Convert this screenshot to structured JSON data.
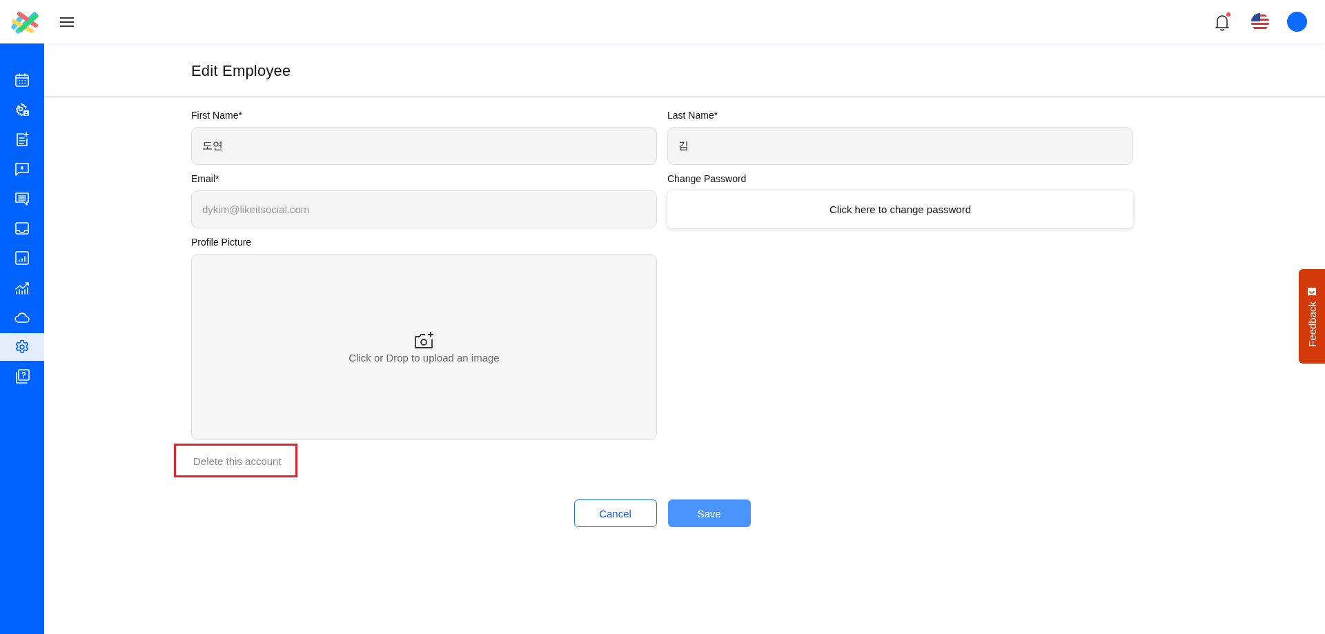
{
  "header": {
    "notifications": {
      "unread": true
    }
  },
  "sidebar": {
    "items": [
      {
        "kind": "calendar",
        "selected": false
      },
      {
        "kind": "gear-person",
        "selected": false
      },
      {
        "kind": "note-add",
        "selected": false
      },
      {
        "kind": "chat-spark",
        "selected": false
      },
      {
        "kind": "chat-lines",
        "selected": false
      },
      {
        "kind": "inbox",
        "selected": false
      },
      {
        "kind": "bar-report",
        "selected": false
      },
      {
        "kind": "trend",
        "selected": false
      },
      {
        "kind": "cloud",
        "selected": false
      },
      {
        "kind": "gear",
        "selected": true
      },
      {
        "kind": "help",
        "selected": false
      }
    ]
  },
  "page": {
    "title": "Edit Employee"
  },
  "form": {
    "first_name": {
      "label": "First Name*",
      "value": "도연"
    },
    "last_name": {
      "label": "Last Name*",
      "value": "김"
    },
    "email": {
      "label": "Email*",
      "placeholder": "dykim@likeitsocial.com"
    },
    "password": {
      "label": "Change Password",
      "button": "Click here to change password"
    },
    "picture": {
      "label": "Profile Picture",
      "hint": "Click or Drop to upload an image"
    },
    "delete_link": {
      "label": "Delete this account",
      "highlighted": true
    },
    "buttons": [
      {
        "kind": "secondary",
        "label": "Cancel"
      },
      {
        "kind": "primary",
        "label": "Save"
      }
    ]
  },
  "feedback_tab": {
    "label": "Feedback"
  }
}
